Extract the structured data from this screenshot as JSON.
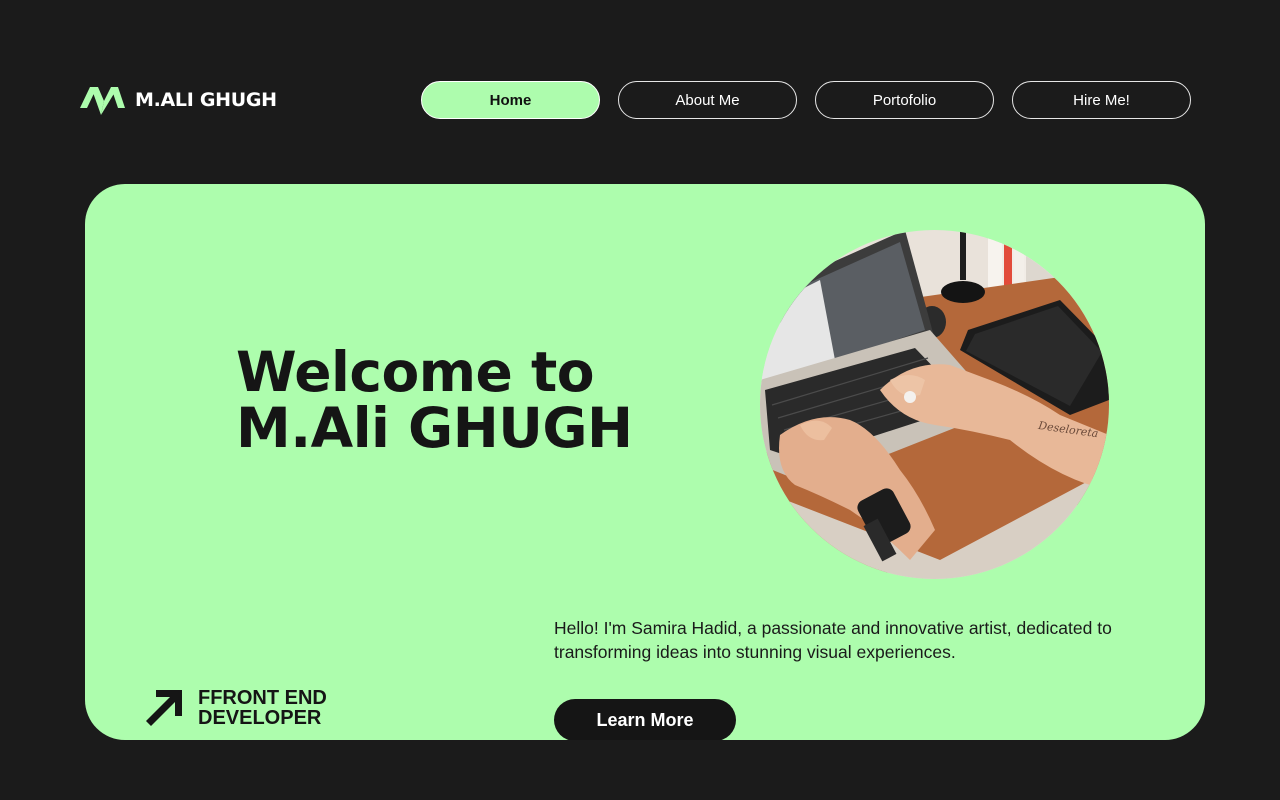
{
  "brand": {
    "name": "M.ALI GHUGH",
    "logo_icon": "double-chevron-m-logo",
    "accent": "#adfdad"
  },
  "nav": {
    "items": [
      {
        "label": "Home",
        "active": true
      },
      {
        "label": "About Me",
        "active": false
      },
      {
        "label": "Portofolio",
        "active": false
      },
      {
        "label": "Hire Me!",
        "active": false
      }
    ]
  },
  "hero": {
    "headline_line1": "Welcome to",
    "headline_line2": "M.Ali GHUGH",
    "intro": "Hello! I'm Samira Hadid, a passionate and innovative artist, dedicated to transforming ideas into stunning visual experiences.",
    "cta_label": "Learn More",
    "role_line1": "FFRONT END",
    "role_line2": "DEVELOPER",
    "role_icon": "arrow-up-right-icon",
    "photo": "laptop-typing-photo"
  },
  "colors": {
    "background": "#1b1b1b",
    "panel": "#adfdad",
    "dark": "#151515"
  }
}
